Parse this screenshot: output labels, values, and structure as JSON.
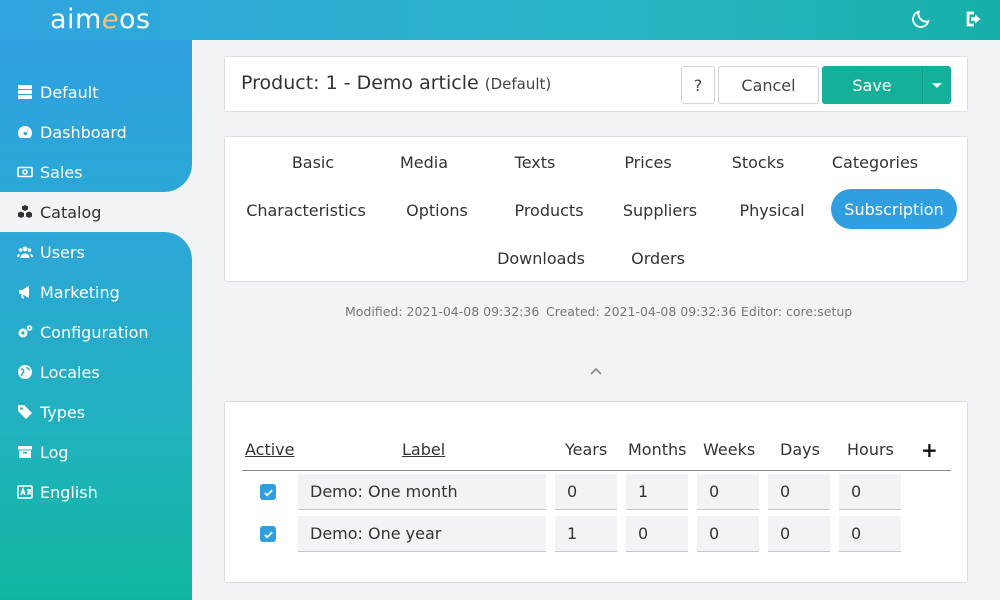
{
  "app": {
    "logo_part1": "aim",
    "logo_e": "e",
    "logo_part2": "os"
  },
  "topbar": {
    "icons": [
      "moon-icon",
      "logout-icon"
    ]
  },
  "sidebar": {
    "items": [
      {
        "label": "Default",
        "icon": "server-icon"
      },
      {
        "label": "Dashboard",
        "icon": "gauge-icon"
      },
      {
        "label": "Sales",
        "icon": "money-icon"
      },
      {
        "label": "Catalog",
        "icon": "cubes-icon",
        "active": true
      },
      {
        "label": "Users",
        "icon": "users-icon"
      },
      {
        "label": "Marketing",
        "icon": "bullhorn-icon"
      },
      {
        "label": "Configuration",
        "icon": "cogs-icon"
      },
      {
        "label": "Locales",
        "icon": "globe-icon"
      },
      {
        "label": "Types",
        "icon": "tag-icon"
      },
      {
        "label": "Log",
        "icon": "archive-icon"
      },
      {
        "label": "English",
        "icon": "language-icon"
      }
    ]
  },
  "header": {
    "title": "Product: 1 - Demo article",
    "site": "(Default)",
    "help_label": "?",
    "cancel_label": "Cancel",
    "save_label": "Save"
  },
  "tabs": [
    {
      "label": "Basic"
    },
    {
      "label": "Media"
    },
    {
      "label": "Texts"
    },
    {
      "label": "Prices"
    },
    {
      "label": "Stocks"
    },
    {
      "label": "Categories"
    },
    {
      "label": "Characteristics"
    },
    {
      "label": "Options"
    },
    {
      "label": "Products"
    },
    {
      "label": "Suppliers"
    },
    {
      "label": "Physical"
    },
    {
      "label": "Subscription",
      "active": true
    },
    {
      "label": "Downloads"
    },
    {
      "label": "Orders"
    }
  ],
  "meta": {
    "modified": "Modified: 2021-04-08 09:32:36",
    "created": "Created: 2021-04-08 09:32:36",
    "editor": "Editor: core:setup"
  },
  "subscription": {
    "headers": {
      "active": "Active",
      "label": "Label",
      "years": "Years",
      "months": "Months",
      "weeks": "Weeks",
      "days": "Days",
      "hours": "Hours",
      "add": "+"
    },
    "rows": [
      {
        "active": true,
        "label": "Demo: One month",
        "years": "0",
        "months": "1",
        "weeks": "0",
        "days": "0",
        "hours": "0"
      },
      {
        "active": true,
        "label": "Demo: One year",
        "years": "1",
        "months": "0",
        "weeks": "0",
        "days": "0",
        "hours": "0"
      }
    ]
  },
  "colors": {
    "accent": "#2f9fe0",
    "save": "#14b09a",
    "sidebar_top": "#30a0e0",
    "sidebar_bottom": "#12b6a0"
  }
}
